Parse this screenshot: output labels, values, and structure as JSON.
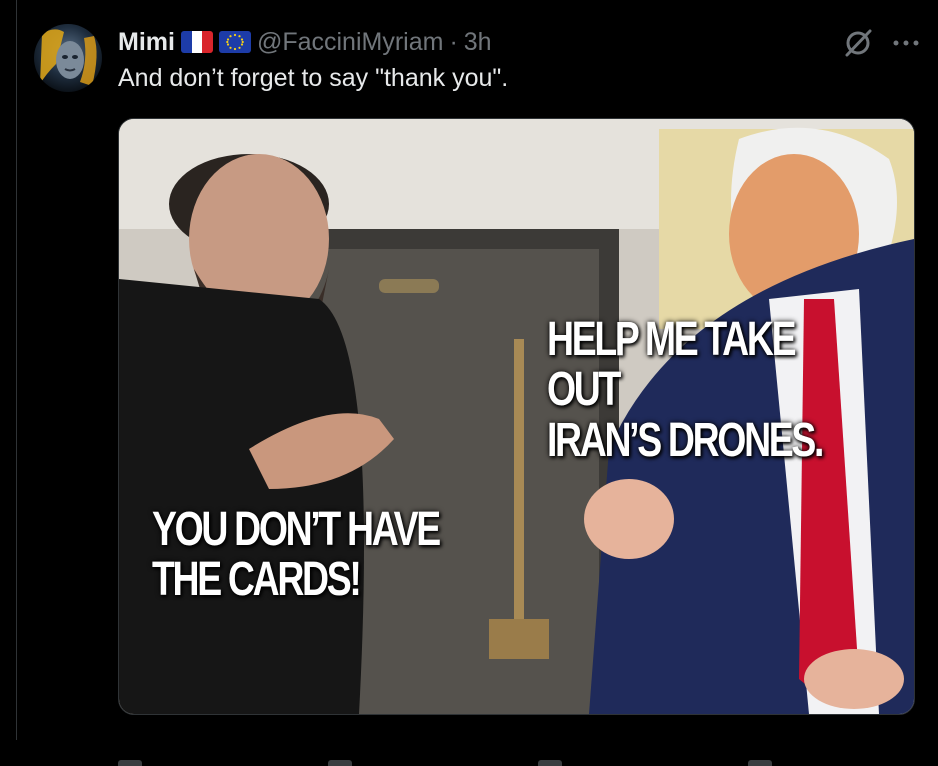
{
  "tweet": {
    "author_name": "Mimi",
    "handle": "@FacciniMyriam",
    "separator": "·",
    "time": "3h",
    "text": "And don’t forget to say \"thank you\".",
    "flags": [
      "france-flag",
      "eu-flag"
    ],
    "icons": [
      "grok-icon",
      "more-icon"
    ]
  },
  "media": {
    "caption_right": "HELP ME TAKE OUT\nIRAN’S DRONES.",
    "caption_left": "YOU DON’T HAVE\nTHE CARDS!"
  },
  "colors": {
    "background": "#000000",
    "text_primary": "#e7e9ea",
    "text_secondary": "#71767b",
    "border": "#2f3336",
    "tie_red": "#c8102e",
    "suit_navy": "#1f2a5a"
  }
}
